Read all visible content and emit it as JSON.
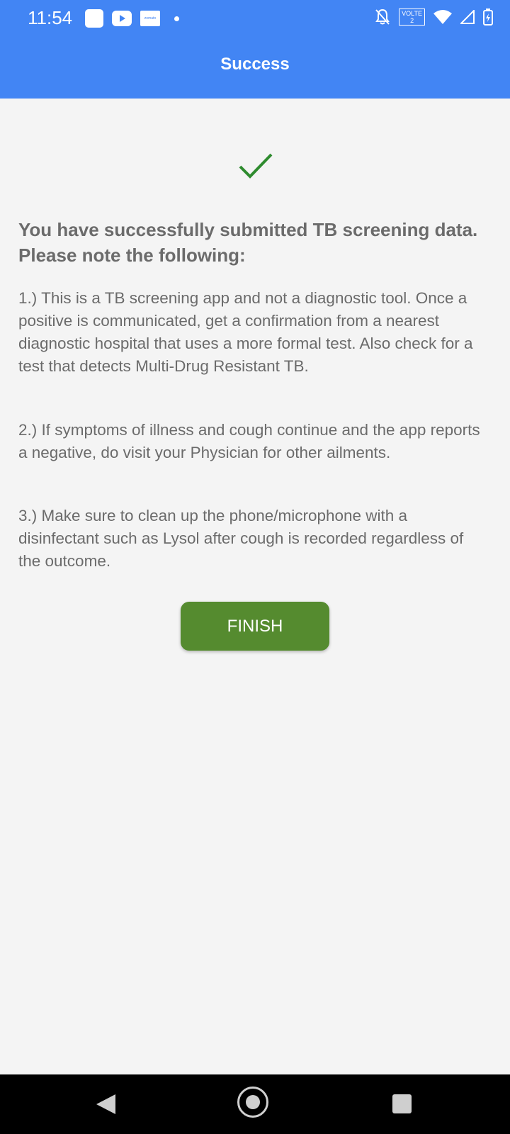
{
  "status_bar": {
    "time": "11:54",
    "notification_icons": [
      "app-square-icon",
      "youtube-icon",
      "zomato-icon",
      "more-notifications-dot-icon"
    ],
    "system_icons": [
      "notifications-off-icon",
      "volte-icon",
      "wifi-icon",
      "signal-icon",
      "battery-charging-icon"
    ],
    "volte_label": "VOLTE",
    "volte_sub": "2",
    "zomato_label": "zomato"
  },
  "app_bar": {
    "title": "Success"
  },
  "content": {
    "success_icon": "checkmark-icon",
    "success_color": "#2e8b2e",
    "heading": "You have successfully submitted TB screening data. Please note the following:",
    "notes": [
      "1.) This is a TB screening app and not a diagnostic tool. Once a positive is communicated, get a confirmation from a nearest diagnostic hospital that uses a more formal test. Also check for a test that detects Multi-Drug Resistant TB.",
      "2.) If symptoms of illness and cough continue and the app reports a negative, do visit your Physician for other ailments.",
      "3.) Make sure to clean up the phone/microphone with a disinfectant such as Lysol after cough is recorded regardless of the outcome."
    ],
    "finish_label": "FINISH"
  },
  "nav_bar": {
    "buttons": [
      "back-icon",
      "home-icon",
      "recent-apps-icon"
    ]
  },
  "colors": {
    "app_bar": "#4285f4",
    "background": "#f4f4f4",
    "button": "#558b2f",
    "text": "#6b6b6b"
  }
}
